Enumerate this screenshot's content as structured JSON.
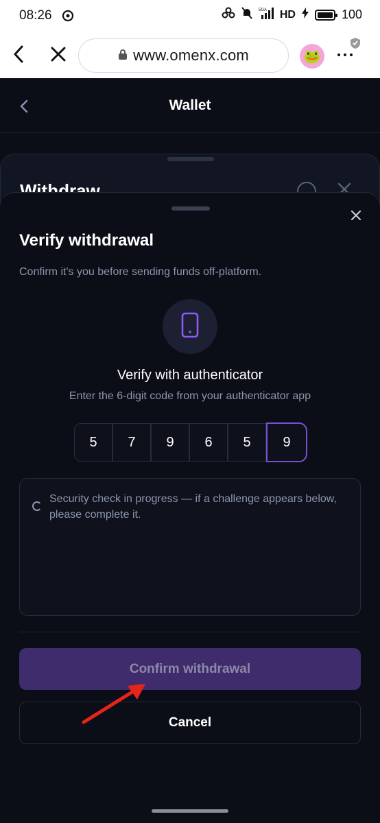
{
  "status_bar": {
    "time": "08:26",
    "network": "HD",
    "battery": "100",
    "signal_label": "5GA"
  },
  "browser": {
    "url": "www.omenx.com",
    "avatar_emoji": "🐸"
  },
  "wallet_header": {
    "title": "Wallet"
  },
  "background_sheet": {
    "title": "Withdraw"
  },
  "verify_sheet": {
    "title": "Verify withdrawal",
    "subtitle": "Confirm it's you before sending funds off-platform.",
    "auth_title": "Verify with authenticator",
    "auth_desc": "Enter the 6-digit code from your authenticator app",
    "code_digits": [
      "5",
      "7",
      "9",
      "6",
      "5",
      "9"
    ],
    "security_message": "Security check in progress — if a challenge appears below, please complete it.",
    "confirm_label": "Confirm withdrawal",
    "cancel_label": "Cancel"
  },
  "colors": {
    "accent": "#7b4fd4",
    "confirm_bg": "#3e2c6c",
    "background": "#0b0e17",
    "annotation_arrow": "#e8231c"
  }
}
